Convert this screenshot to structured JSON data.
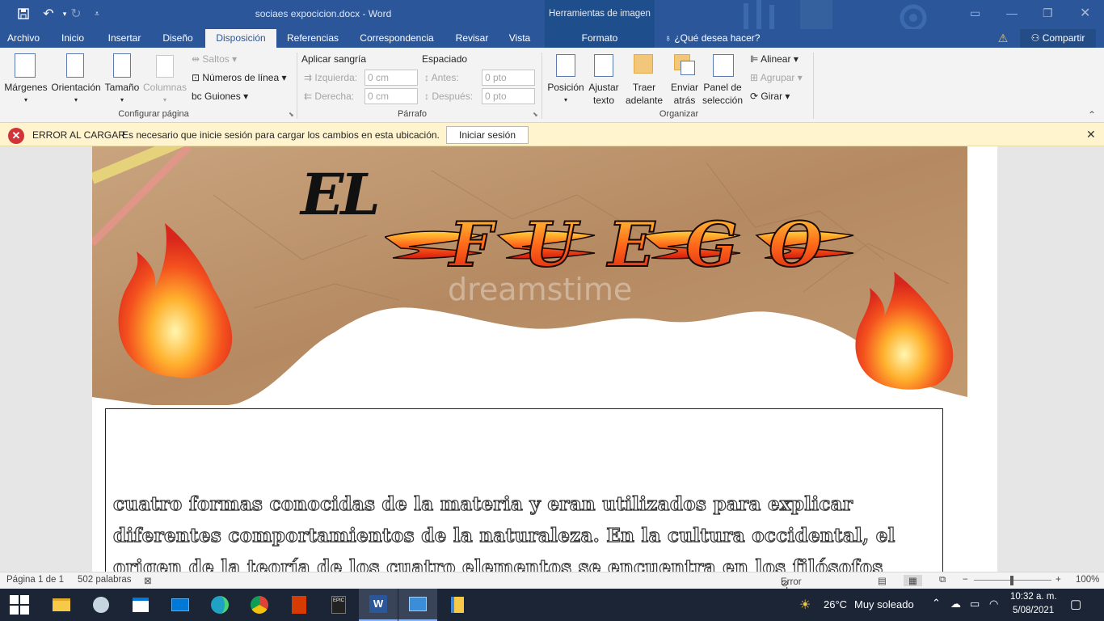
{
  "titlebar": {
    "document_title": "sociaes expocicion.docx  -  Word",
    "context_header": "Herramientas de imagen"
  },
  "tabs": [
    {
      "label": "Archivo"
    },
    {
      "label": "Inicio"
    },
    {
      "label": "Insertar"
    },
    {
      "label": "Diseño"
    },
    {
      "label": "Disposición"
    },
    {
      "label": "Referencias"
    },
    {
      "label": "Correspondencia"
    },
    {
      "label": "Revisar"
    },
    {
      "label": "Vista"
    },
    {
      "label": "Formato"
    }
  ],
  "tell_me": "¿Qué desea hacer?",
  "share": "Compartir",
  "ribbon": {
    "page_setup": {
      "margins": "Márgenes",
      "orientation": "Orientación",
      "size": "Tamaño",
      "columns": "Columnas",
      "breaks": "Saltos",
      "line_numbers": "Números de línea",
      "hyphenation": "Guiones",
      "group_label": "Configurar página"
    },
    "paragraph": {
      "indent_title": "Aplicar sangría",
      "left": "Izquierda:",
      "right": "Derecha:",
      "left_value": "0 cm",
      "right_value": "0 cm",
      "spacing_title": "Espaciado",
      "before": "Antes:",
      "after": "Después:",
      "before_value": "0 pto",
      "after_value": "0 pto",
      "group_label": "Párrafo"
    },
    "arrange": {
      "position": "Posición",
      "wrap_1": "Ajustar",
      "wrap_2": "texto",
      "forward_1": "Traer",
      "forward_2": "adelante",
      "backward_1": "Enviar",
      "backward_2": "atrás",
      "pane_1": "Panel de",
      "pane_2": "selección",
      "align": "Alinear",
      "group": "Agrupar",
      "rotate": "Girar",
      "group_label": "Organizar"
    }
  },
  "message_bar": {
    "title": "ERROR AL CARGAR",
    "message": "Es necesario que inicie sesión para cargar los cambios en esta ubicación.",
    "button": "Iniciar sesión"
  },
  "document": {
    "heading_el": "EL",
    "heading_fuego": "FUEGO",
    "watermark": "dreamstime",
    "lines": [
      "cuatro formas conocidas de la materia y eran utilizados para explicar",
      "diferentes comportamientos de la naturaleza. En la cultura occidental, el",
      "origen de la teoría de los cuatro elementos se encuentra en los filósofos"
    ]
  },
  "status": {
    "page": "Página 1 de 1",
    "words": "502 palabras",
    "upload": "Error al cargar",
    "zoom": "100%"
  },
  "taskbar": {
    "weather_temp": "26°C",
    "weather_desc": "Muy soleado",
    "time": "10:32 a. m.",
    "date": "5/08/2021"
  },
  "colors": {
    "accent": "#2b579a",
    "message_bg": "#fff4ce",
    "error": "#d13438"
  }
}
